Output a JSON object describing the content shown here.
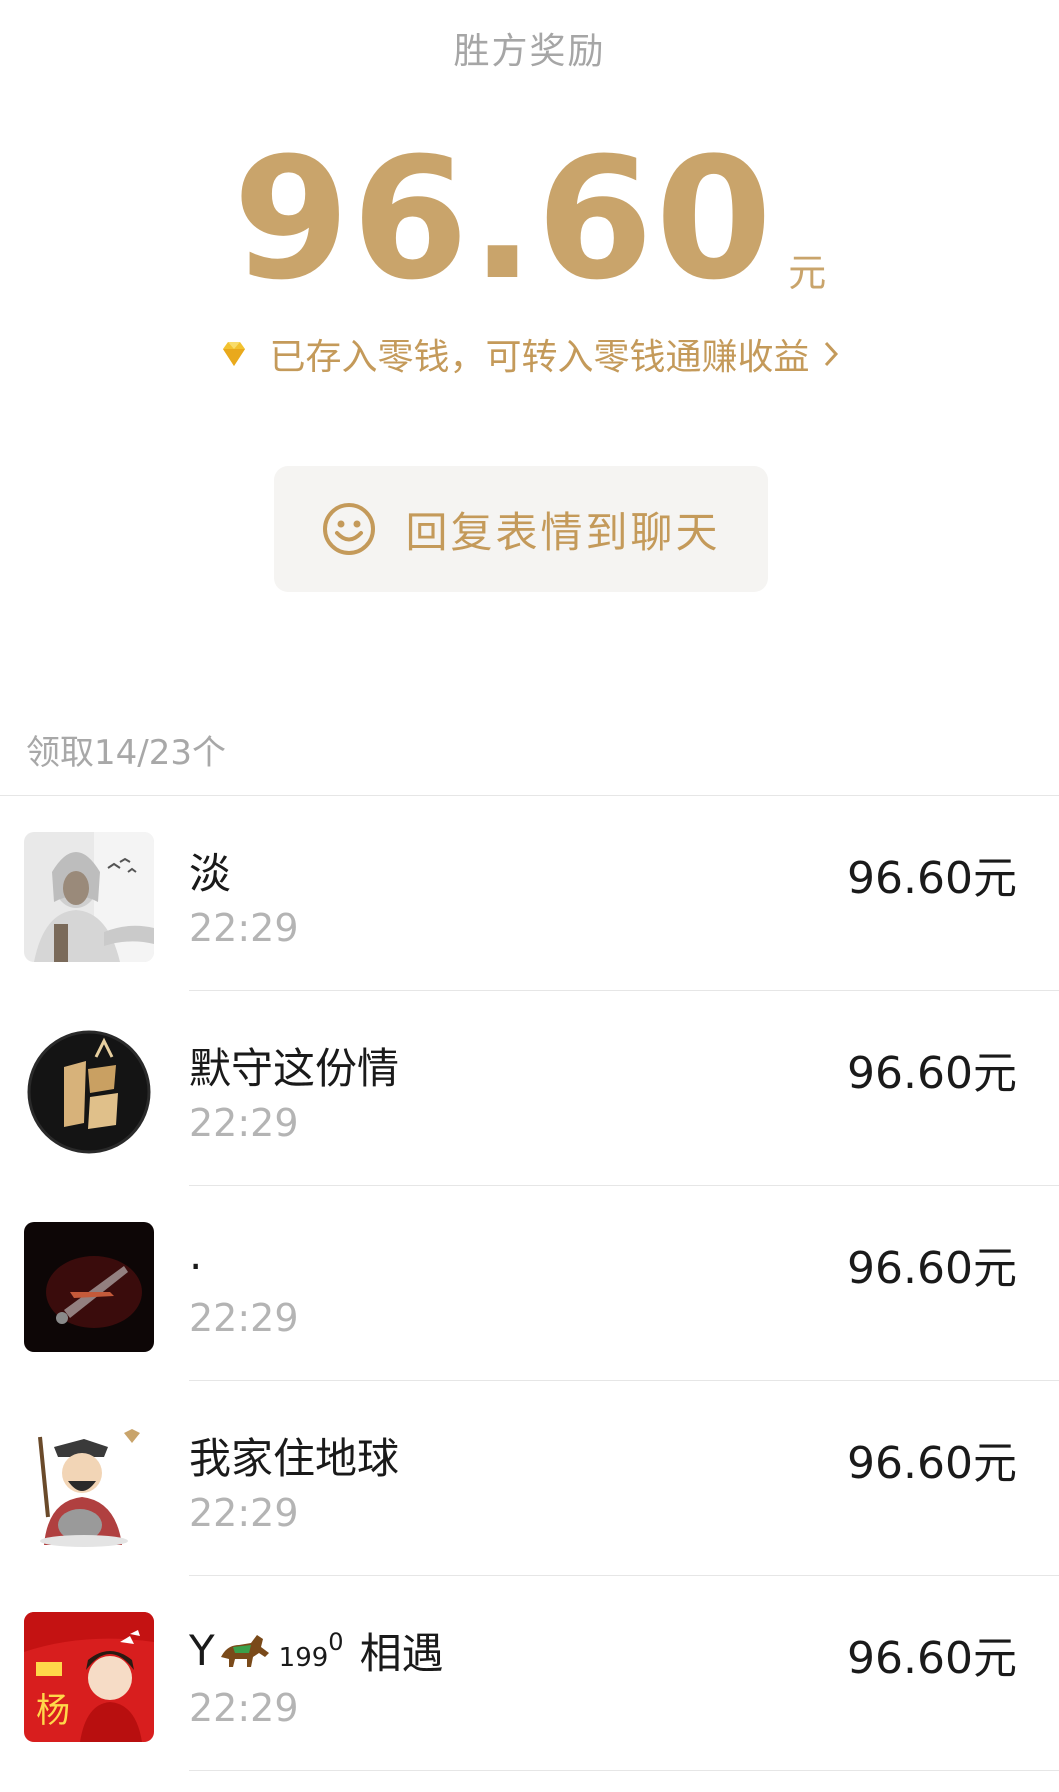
{
  "header": {
    "title": "胜方奖励",
    "amount": "96.60",
    "amount_unit": "元",
    "deposit_text": "已存入零钱，可转入零钱通赚收益"
  },
  "reply_button": {
    "label": "回复表情到聊天"
  },
  "claim_summary": "领取14/23个",
  "records": [
    {
      "name": "淡",
      "time": "22:29",
      "amount": "96.60元",
      "avatar": "hooded-man-avatar"
    },
    {
      "name": "默守这份情",
      "time": "22:29",
      "amount": "96.60元",
      "avatar": "road-logo-avatar"
    },
    {
      "name": ".",
      "time": "22:29",
      "amount": "96.60元",
      "avatar": "dark-light-avatar"
    },
    {
      "name": "我家住地球",
      "time": "22:29",
      "amount": "96.60元",
      "avatar": "cartoon-avatar"
    },
    {
      "name_prefix": "Y",
      "name_superscript": "199",
      "name_zero": "0",
      "name_suffix": "相遇",
      "time": "22:29",
      "amount": "96.60元",
      "avatar": "red-poster-avatar"
    }
  ],
  "colors": {
    "gold": "#c9a46b",
    "gold_text": "#c49a5a",
    "gray": "#a6a6a6"
  }
}
